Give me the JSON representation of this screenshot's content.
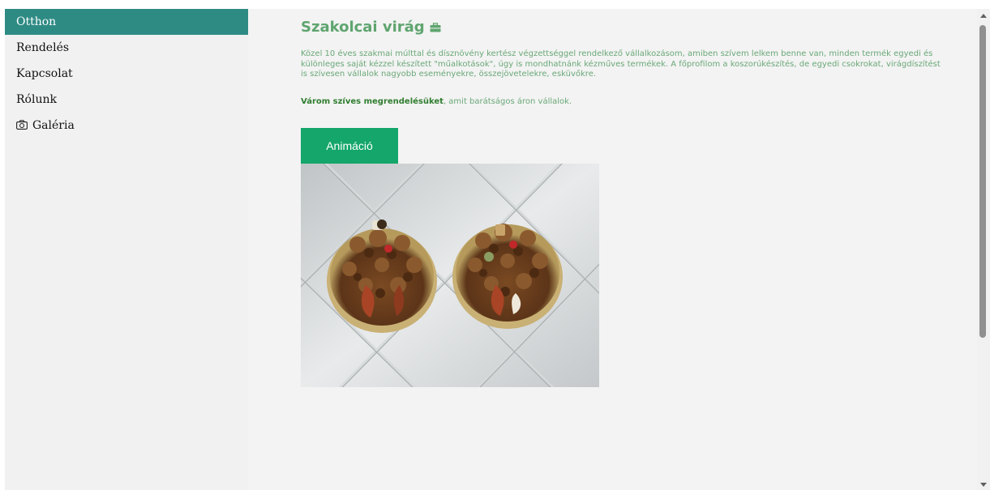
{
  "sidebar": {
    "items": [
      {
        "label": "Otthon"
      },
      {
        "label": "Rendelés"
      },
      {
        "label": "Kapcsolat"
      },
      {
        "label": "Rólunk"
      },
      {
        "label": "Galéria",
        "icon": "camera-icon"
      }
    ]
  },
  "main": {
    "title": "Szakolcai virág",
    "title_icon": "briefcase-icon",
    "description": "Közel 10 éves szakmai múlttal és dísznövény kertész végzettséggel rendelkező vállalkozásom, amiben szívem lelkem benne van, minden termék egyedi és különleges saját kézzel készített \"műalkotások\", úgy is mondhatnánk kézműves termékek. A főprofilom a koszorúkészítés, de egyedi csokrokat, virágdíszítést is szívesen vállalok nagyobb eseményekre, összejövetelekre, esküvőkre.",
    "order_strong": "Várom szíves megrendelésüket",
    "order_rest": ", amit barátságos áron vállalok.",
    "tab_label": "Animáció"
  },
  "colors": {
    "sidebar_active": "#2e8b84",
    "title_green": "#5fa56f",
    "text_green": "#6aa878",
    "button_green": "#14a66a"
  }
}
